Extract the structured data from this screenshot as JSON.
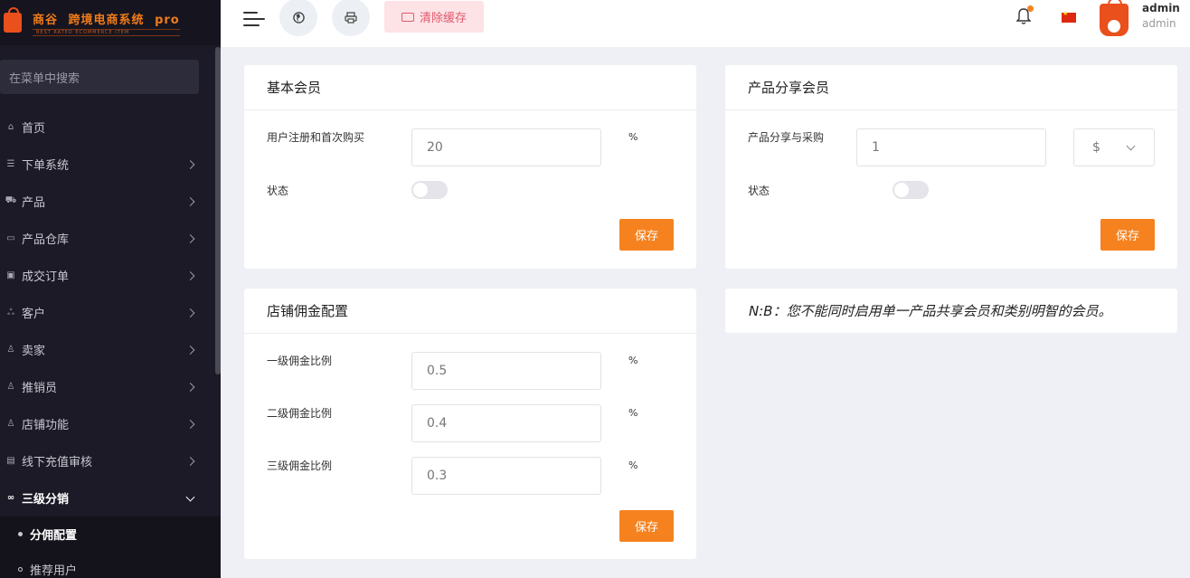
{
  "logo": {
    "brand": "商谷",
    "product": "跨境电商系统",
    "edition": "pro",
    "tagline": "BEST RATED ECOMMERCE ITEM"
  },
  "sidebar": {
    "search_placeholder": "在菜单中搜索",
    "items": [
      {
        "label": "首页",
        "icon": "home-icon"
      },
      {
        "label": "下单系统",
        "icon": "list-icon"
      },
      {
        "label": "产品",
        "icon": "cart-icon"
      },
      {
        "label": "产品仓库",
        "icon": "box-icon"
      },
      {
        "label": "成交订单",
        "icon": "order-icon"
      },
      {
        "label": "客户",
        "icon": "users-icon"
      },
      {
        "label": "卖家",
        "icon": "user-icon"
      },
      {
        "label": "推销员",
        "icon": "user-icon"
      },
      {
        "label": "店铺功能",
        "icon": "user-icon"
      },
      {
        "label": "线下充值审核",
        "icon": "money-icon"
      },
      {
        "label": "三级分销",
        "icon": "link-icon"
      }
    ],
    "sub_items": [
      {
        "label": "分佣配置"
      },
      {
        "label": "推荐用户"
      }
    ]
  },
  "header": {
    "clear_cache": "清除缓存",
    "user_name": "admin",
    "user_role": "admin",
    "notification_dot_color": "#f5821f"
  },
  "basic_member": {
    "title": "基本会员",
    "field_label": "用户注册和首次购买",
    "field_value": "20",
    "unit": "%",
    "status_label": "状态",
    "status_on": false,
    "save": "保存"
  },
  "product_share": {
    "title": "产品分享会员",
    "field_label": "产品分享与采购",
    "field_value": "1",
    "currency": "$",
    "status_label": "状态",
    "status_on": false,
    "save": "保存"
  },
  "store_commission": {
    "title": "店铺佣金配置",
    "levels": [
      {
        "label": "一级佣金比例",
        "value": "0.5",
        "unit": "%"
      },
      {
        "label": "二级佣金比例",
        "value": "0.4",
        "unit": "%"
      },
      {
        "label": "三级佣金比例",
        "value": "0.3",
        "unit": "%"
      }
    ],
    "save": "保存"
  },
  "note": "N:B：您不能同时启用单一产品共享会员和类别明智的会员。",
  "colors": {
    "accent": "#f5821f",
    "sidebar_bg": "#1b1a26",
    "clear_cache_bg": "#fde2e6"
  }
}
